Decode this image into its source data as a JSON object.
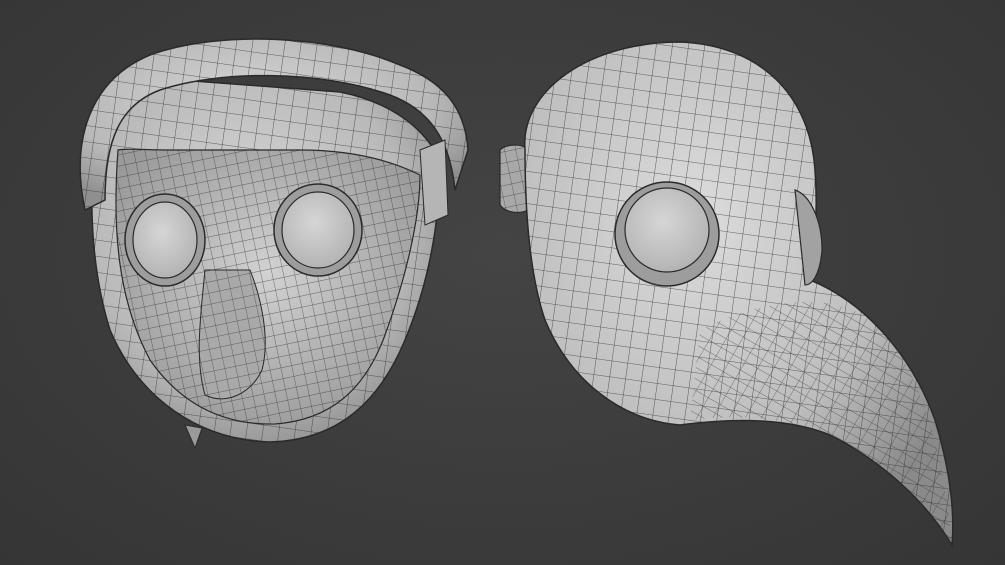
{
  "scene": {
    "background_color": "#3d3d3d",
    "surface_color": "#c9c9c9",
    "wire_color": "#2a2a2a",
    "eye_color": "#cfcfcf",
    "objects": [
      {
        "name": "plague-mask-back-view"
      },
      {
        "name": "plague-mask-side-view"
      }
    ]
  }
}
